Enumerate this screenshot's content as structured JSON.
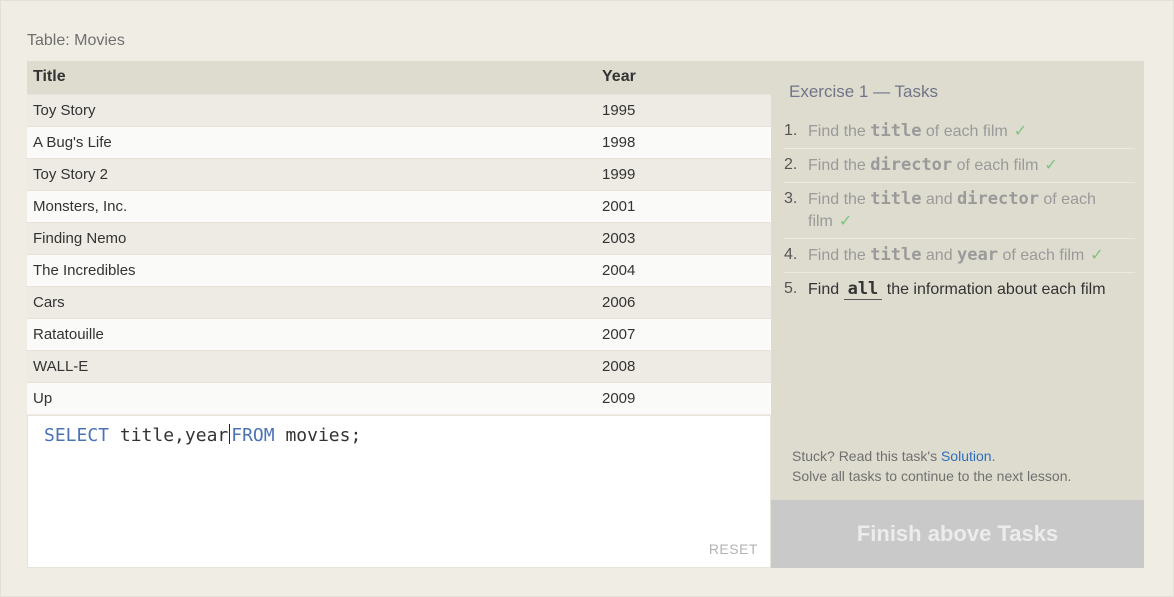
{
  "table_label": "Table: Movies",
  "results": {
    "columns": [
      "Title",
      "Year"
    ],
    "rows": [
      [
        "Toy Story",
        "1995"
      ],
      [
        "A Bug's Life",
        "1998"
      ],
      [
        "Toy Story 2",
        "1999"
      ],
      [
        "Monsters, Inc.",
        "2001"
      ],
      [
        "Finding Nemo",
        "2003"
      ],
      [
        "The Incredibles",
        "2004"
      ],
      [
        "Cars",
        "2006"
      ],
      [
        "Ratatouille",
        "2007"
      ],
      [
        "WALL-E",
        "2008"
      ],
      [
        "Up",
        "2009"
      ]
    ]
  },
  "editor": {
    "kw_select": "SELECT",
    "part1": " title,year",
    "kw_from": "FROM",
    "part2": " movies;",
    "reset_label": "RESET"
  },
  "exercise": {
    "title": "Exercise 1 — Tasks",
    "tasks": [
      {
        "num": "1.",
        "pre": "Find the ",
        "code1": "title",
        "mid": "",
        "code2": "",
        "post": " of each film",
        "check": "✓"
      },
      {
        "num": "2.",
        "pre": "Find the ",
        "code1": "director",
        "mid": "",
        "code2": "",
        "post": " of each film",
        "check": "✓"
      },
      {
        "num": "3.",
        "pre": "Find the ",
        "code1": "title",
        "mid": " and ",
        "code2": "director",
        "post": " of each film",
        "check": "✓"
      },
      {
        "num": "4.",
        "pre": "Find the ",
        "code1": "title",
        "mid": " and ",
        "code2": "year",
        "post": " of each film",
        "check": "✓"
      },
      {
        "num": "5.",
        "pre": "Find ",
        "code1": "all",
        "mid": "",
        "code2": "",
        "post": " the information about each film",
        "check": ""
      }
    ]
  },
  "help": {
    "stuck_text": "Stuck? Read this task's ",
    "solution_link": "Solution",
    "stuck_end": ".",
    "continue_text": "Solve all tasks to continue to the next lesson."
  },
  "finish_button": "Finish above Tasks",
  "colors": {
    "keyword": "#4b73b3",
    "check": "#7fc37f",
    "link": "#2e6fbd"
  }
}
